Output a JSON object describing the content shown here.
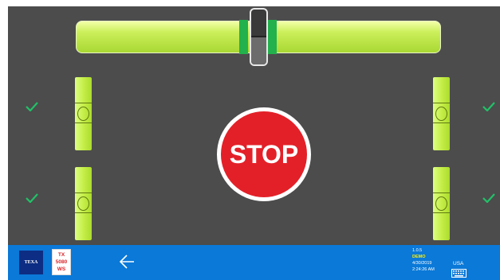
{
  "center": {
    "stop_label": "STOP"
  },
  "wheels": [
    {
      "id": "front-left",
      "status": "ok"
    },
    {
      "id": "front-right",
      "status": "ok"
    },
    {
      "id": "rear-left",
      "status": "ok"
    },
    {
      "id": "rear-right",
      "status": "ok"
    }
  ],
  "footer": {
    "brand_logo": "TEXA",
    "product_logo_lines": [
      "TX",
      "5080",
      "WS"
    ],
    "version": "1.0.5",
    "mode": "DEMO",
    "date": "4/30/2019",
    "time": "2:24:26 AM",
    "region": "USA",
    "back_icon": "arrow-left-icon",
    "keyboard_icon": "keyboard-icon"
  },
  "colors": {
    "background": "#4c4c4c",
    "level_green": "#c6ee49",
    "target_green": "#22b14c",
    "stop_red": "#e32028",
    "footer_blue": "#0a79d8",
    "check_green": "#21c168",
    "demo_yellow": "#ffee00"
  }
}
